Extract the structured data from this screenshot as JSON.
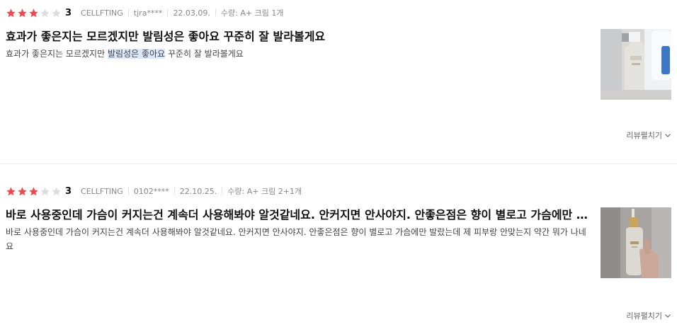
{
  "reviews": [
    {
      "rating": 3,
      "max_rating": 5,
      "score": "3",
      "seller": "CELLFTING",
      "user": "tjra****",
      "date": "22.03.09.",
      "qty": "수량: A+ 크림 1개",
      "title": "효과가 좋은지는 모르겠지만 발림성은 좋아요 꾸준히 잘 발라볼게요",
      "body_before": "효과가 좋은지는 모르겠지만 ",
      "body_highlight": "발림성은 좋아요",
      "body_after": " 꾸준히 잘 발라볼게요",
      "more_label": "리뷰펼치기"
    },
    {
      "rating": 3,
      "max_rating": 5,
      "score": "3",
      "seller": "CELLFTING",
      "user": "0102****",
      "date": "22.10.25.",
      "qty": "수량: A+ 크림 2+1개",
      "title": "바로 사용중인데 가슴이 커지는건 계속더 사용해봐야 알것같네요. 안커지면 안사야지. 안좋은점은 향이 별로고 가슴에만 발랐는데 제 피부랑 안맞는지 약간 뭐가 나네요",
      "body": "바로 사용중인데 가슴이 커지는건 계속더 사용해봐야 알것같네요. 안커지면 안사야지. 안좋은점은 향이 별로고 가슴에만 발랐는데 제 피부랑 안맞는지 약간 뭐가 나네요",
      "more_label": "리뷰펼치기"
    }
  ],
  "colors": {
    "star_filled": "#f2464f",
    "star_empty": "#dddddd",
    "highlight": "#dbe8fb"
  }
}
